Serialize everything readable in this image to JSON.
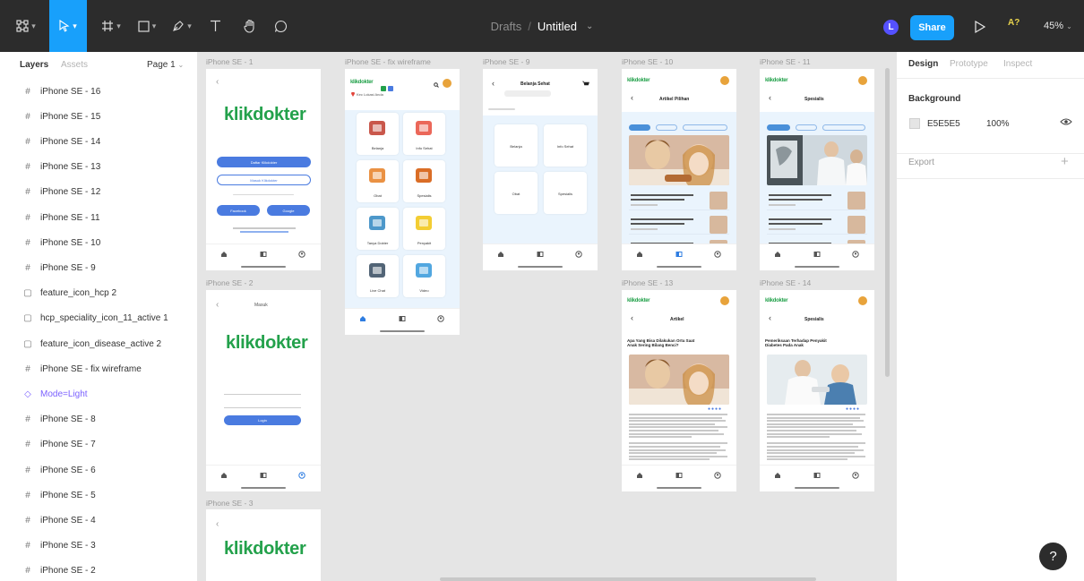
{
  "toolbar": {
    "breadcrumb": "Drafts",
    "separator": "/",
    "file_name": "Untitled",
    "avatar_initial": "L",
    "share_label": "Share",
    "a11y_label": "A?",
    "zoom_label": "45%",
    "icons": [
      "figma-menu-icon",
      "move-tool-icon",
      "frame-tool-icon",
      "shape-tool-icon",
      "pen-tool-icon",
      "text-tool-icon",
      "hand-tool-icon",
      "comment-tool-icon"
    ]
  },
  "left_panel": {
    "tab_layers": "Layers",
    "tab_assets": "Assets",
    "page_label": "Page 1",
    "layers": [
      {
        "label": "iPhone SE - 16",
        "icon": "frame-icon"
      },
      {
        "label": "iPhone SE - 15",
        "icon": "frame-icon"
      },
      {
        "label": "iPhone SE - 14",
        "icon": "frame-icon"
      },
      {
        "label": "iPhone SE - 13",
        "icon": "frame-icon"
      },
      {
        "label": "iPhone SE - 12",
        "icon": "frame-icon"
      },
      {
        "label": "iPhone SE - 11",
        "icon": "frame-icon"
      },
      {
        "label": "iPhone SE - 10",
        "icon": "frame-icon"
      },
      {
        "label": "iPhone SE - 9",
        "icon": "frame-icon"
      },
      {
        "label": "feature_icon_hcp 2",
        "icon": "image-icon"
      },
      {
        "label": "hcp_speciality_icon_11_active 1",
        "icon": "image-icon"
      },
      {
        "label": "feature_icon_disease_active 2",
        "icon": "image-icon"
      },
      {
        "label": "iPhone SE - fix wireframe",
        "icon": "frame-icon"
      },
      {
        "label": "Mode=Light",
        "icon": "component-icon"
      },
      {
        "label": "iPhone SE - 8",
        "icon": "frame-icon"
      },
      {
        "label": "iPhone SE - 7",
        "icon": "frame-icon"
      },
      {
        "label": "iPhone SE - 6",
        "icon": "frame-icon"
      },
      {
        "label": "iPhone SE - 5",
        "icon": "frame-icon"
      },
      {
        "label": "iPhone SE - 4",
        "icon": "frame-icon"
      },
      {
        "label": "iPhone SE - 3",
        "icon": "frame-icon"
      },
      {
        "label": "iPhone SE - 2",
        "icon": "frame-icon"
      }
    ]
  },
  "canvas": {
    "frames": {
      "se1": {
        "label": "iPhone SE - 1",
        "btn_primary": "Daftar Klikdokter",
        "btn_secondary": "Masuk Klikdokter",
        "social_1": "Facebook",
        "social_2": "Google"
      },
      "se2": {
        "label": "iPhone SE - 2",
        "header": "Masuk",
        "login_btn": "Login"
      },
      "se3": {
        "label": "iPhone SE - 3"
      },
      "fix": {
        "label": "iPhone SE - fix wireframe",
        "location": "Kec Lokasi Anda",
        "tiles": [
          "Belanja",
          "Info Sehat",
          "Obat",
          "Spesialis",
          "Tanya Dokter",
          "Penyakit",
          "Live Chat",
          "Video"
        ]
      },
      "se9": {
        "label": "iPhone SE - 9",
        "header": "Belanja Sehat",
        "tiles": [
          "Belanja",
          "Info Sehat",
          "Obat",
          "Spesialis"
        ]
      },
      "se10": {
        "label": "iPhone SE - 10",
        "header": "Artikel Pilihan"
      },
      "se11": {
        "label": "iPhone SE - 11",
        "header": "Spesialis"
      },
      "se13": {
        "label": "iPhone SE - 13",
        "header": "Artikel",
        "title": "Apa Yang Bisa Dilakukan Ortu Saat Anak Sering Bilang Benci?"
      },
      "se14": {
        "label": "iPhone SE - 14",
        "header": "Spesialis",
        "title": "Pemeriksaan Terhadap Penyakit Diabetes Pada Anak"
      }
    },
    "brand_name": "klikdokter",
    "nav_labels": [
      "Beranda",
      "Artikel",
      "Profil"
    ]
  },
  "right_panel": {
    "tab_design": "Design",
    "tab_prototype": "Prototype",
    "tab_inspect": "Inspect",
    "background_title": "Background",
    "background_hex": "E5E5E5",
    "background_opacity": "100%",
    "export_title": "Export",
    "help_label": "?"
  },
  "colors": {
    "toolbar_bg": "#2c2c2c",
    "accent": "#18a0fb",
    "canvas_bg": "#e5e5e5",
    "brand_green": "#23a14b",
    "brand_blue": "#4a7be0"
  }
}
